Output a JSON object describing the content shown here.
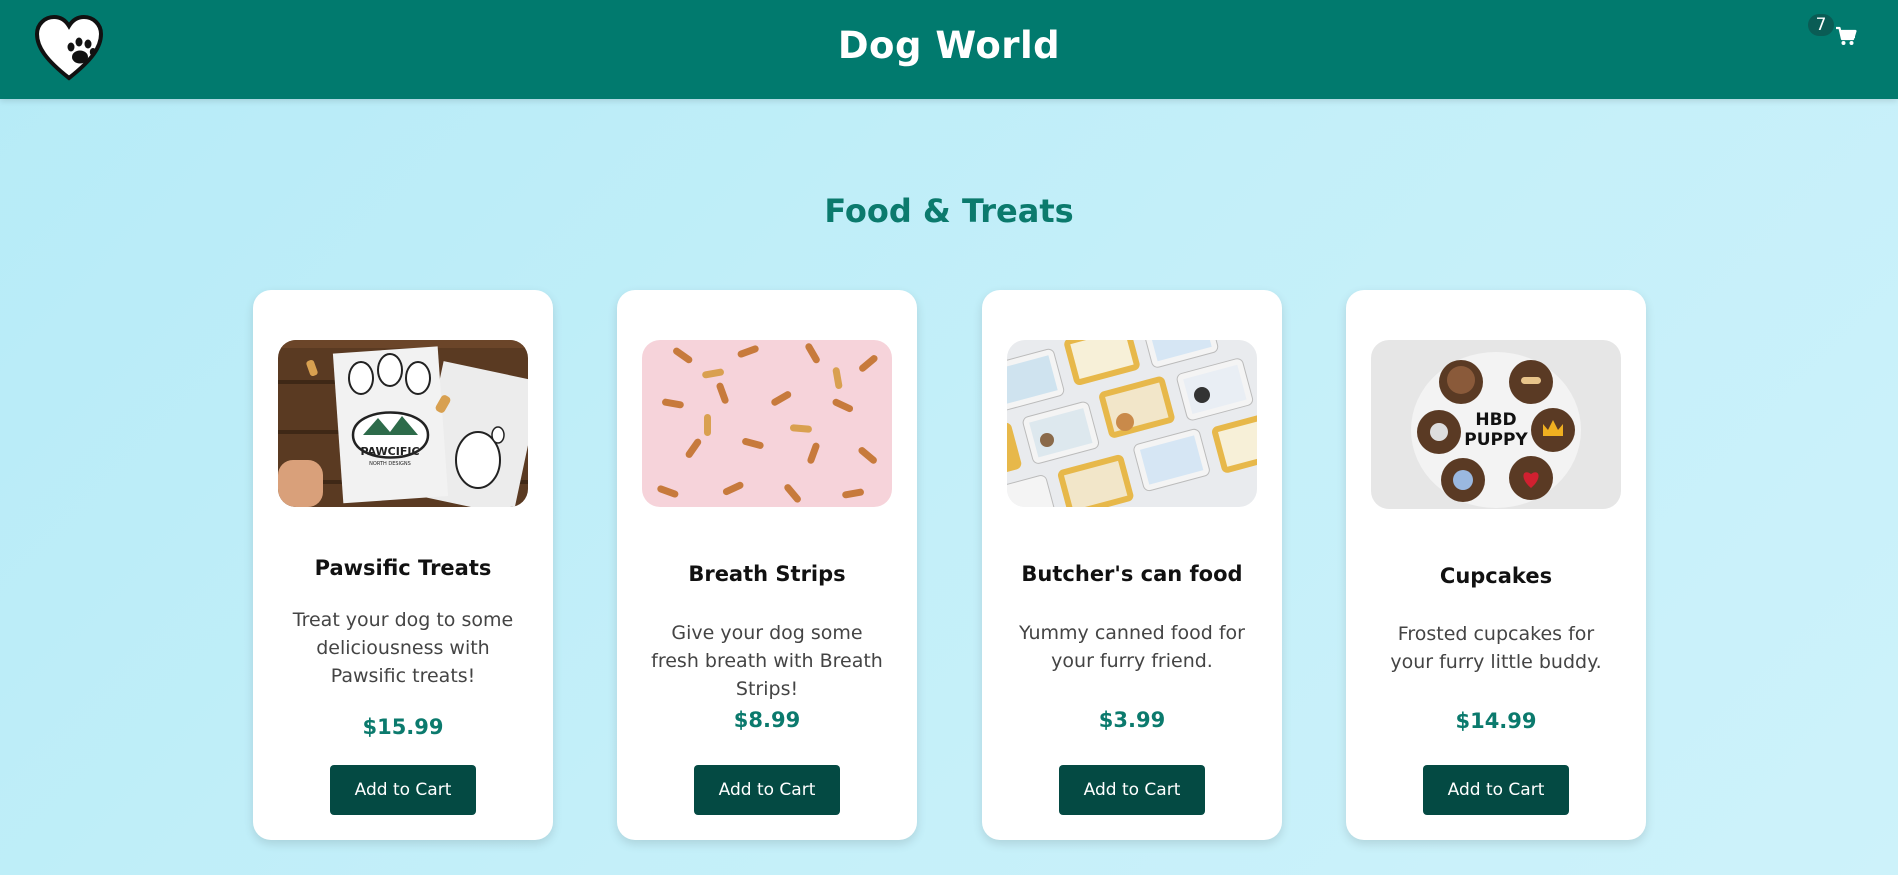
{
  "header": {
    "title": "Dog World",
    "logo_icon": "heart-paw-logo",
    "cart": {
      "count": "7",
      "icon": "cart-icon"
    }
  },
  "section": {
    "title": "Food & Treats"
  },
  "products": [
    {
      "name": "Pawsific Treats",
      "description": "Treat your dog to some deliciousness with Pawsific treats!",
      "price": "$15.99",
      "button_label": "Add to Cart"
    },
    {
      "name": "Breath Strips",
      "description": "Give your dog some fresh breath with Breath Strips!",
      "price": "$8.99",
      "button_label": "Add to Cart"
    },
    {
      "name": "Butcher's can food",
      "description": "Yummy canned food for your furry friend.",
      "price": "$3.99",
      "button_label": "Add to Cart"
    },
    {
      "name": "Cupcakes",
      "description": "Frosted cupcakes for your furry little buddy.",
      "price": "$14.99",
      "button_label": "Add to Cart"
    }
  ],
  "product_images": {
    "pawsific_package_text": [
      "PAWCIFIC",
      "NORTH DESIGNS"
    ],
    "cupcake_board_text": [
      "HBD",
      "PUPPY"
    ]
  },
  "colors": {
    "header_bg": "#017a6e",
    "accent": "#0b7a6d",
    "button_bg": "#044a43",
    "page_bg": "#c3eff9"
  }
}
